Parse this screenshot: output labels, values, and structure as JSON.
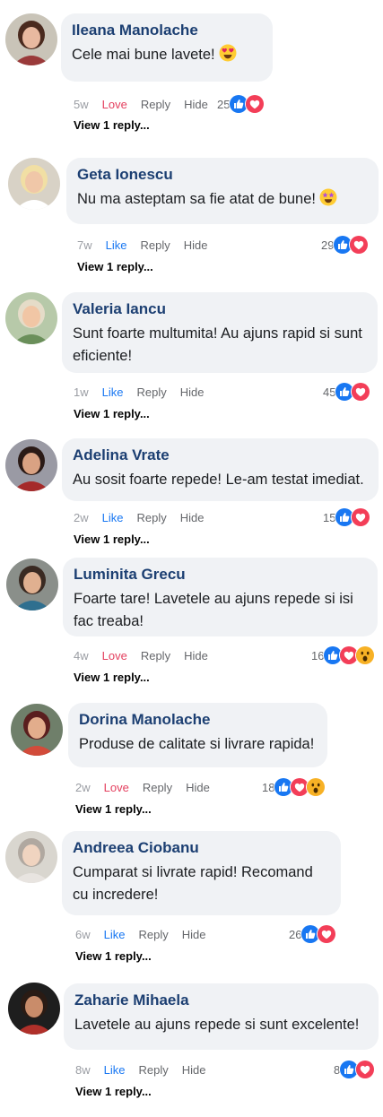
{
  "labels": {
    "reply": "Reply",
    "hide": "Hide",
    "view_replies": "View 1 reply..."
  },
  "colors": {
    "name": "#1c3f72",
    "bubble": "#f0f2f5",
    "like": "#1877f2",
    "love": "#e4405f"
  },
  "comments": [
    {
      "name": "Ileana Manolache",
      "text": "Cele mai bune lavete!",
      "emoji": "heart-eyes-emoji",
      "time": "5w",
      "reaction_action": "Love",
      "count": "25",
      "reactions": [
        "like",
        "love"
      ]
    },
    {
      "name": "Geta Ionescu",
      "text": "Nu ma asteptam sa fie atat de bune!",
      "emoji": "star-struck-emoji",
      "time": "7w",
      "reaction_action": "Like",
      "count": "29",
      "reactions": [
        "like",
        "love"
      ]
    },
    {
      "name": "Valeria Iancu",
      "text": "Sunt foarte multumita! Au ajuns rapid si sunt eficiente!",
      "time": "1w",
      "reaction_action": "Like",
      "count": "45",
      "reactions": [
        "like",
        "love"
      ]
    },
    {
      "name": "Adelina Vrate",
      "text": "Au sosit foarte repede! Le-am testat imediat.",
      "time": "2w",
      "reaction_action": "Like",
      "count": "15",
      "reactions": [
        "like",
        "love"
      ]
    },
    {
      "name": "Luminita Grecu",
      "text": "Foarte tare! Lavetele au ajuns repede si isi fac treaba!",
      "time": "4w",
      "reaction_action": "Love",
      "count": "16",
      "reactions": [
        "like",
        "love",
        "wow"
      ]
    },
    {
      "name": "Dorina Manolache",
      "text": "Produse de calitate si livrare rapida!",
      "time": "2w",
      "reaction_action": "Love",
      "count": "18",
      "reactions": [
        "like",
        "love",
        "wow"
      ]
    },
    {
      "name": "Andreea Ciobanu",
      "text": "Cumparat si livrate rapid! Recomand cu incredere!",
      "time": "6w",
      "reaction_action": "Like",
      "count": "26",
      "reactions": [
        "like",
        "love"
      ]
    },
    {
      "name": "Zaharie Mihaela",
      "text": "Lavetele au ajuns repede si sunt excelente!",
      "time": "8w",
      "reaction_action": "Like",
      "count": "8",
      "reactions": [
        "like",
        "love"
      ]
    }
  ]
}
